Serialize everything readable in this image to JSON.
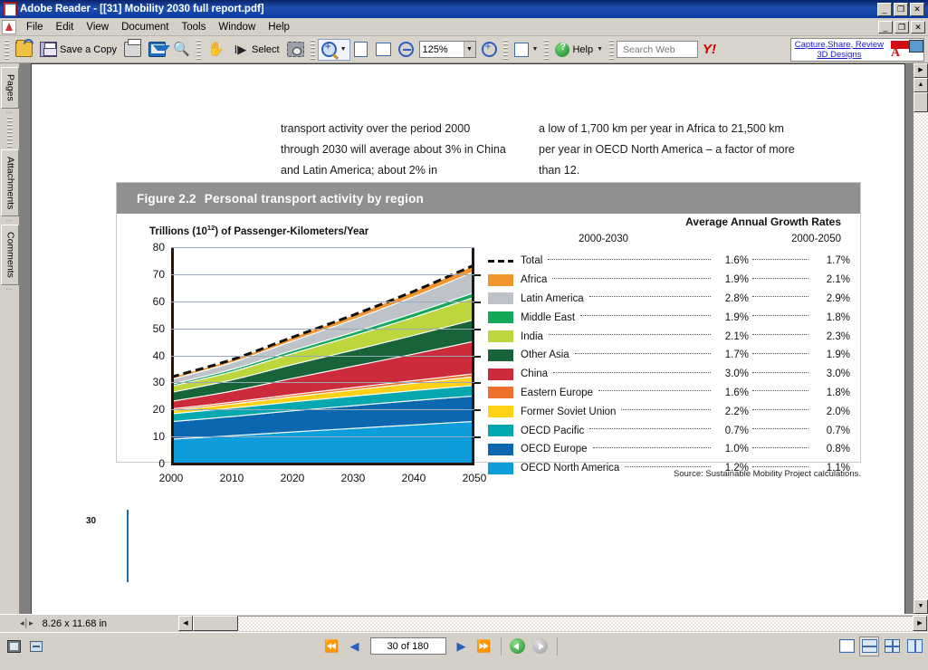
{
  "window": {
    "title": "Adobe Reader - [[31] Mobility 2030 full report.pdf]",
    "minimize": "_",
    "restore": "❐",
    "close": "✕"
  },
  "menu": [
    {
      "label": "File"
    },
    {
      "label": "Edit"
    },
    {
      "label": "View"
    },
    {
      "label": "Document"
    },
    {
      "label": "Tools"
    },
    {
      "label": "Window"
    },
    {
      "label": "Help"
    }
  ],
  "toolbar": {
    "open_label": "",
    "save_label": "Save a Copy",
    "print_label": "",
    "email_label": "",
    "search_label": "",
    "hand_label": "",
    "select_label": "Select",
    "snapshot_label": "",
    "zoom_value": "125%",
    "zoom_placeholder": "125%",
    "help_label": "Help",
    "search_web_value": "",
    "search_web_placeholder": "Search Web",
    "yahoo_label": "Y!",
    "promo_line1": "Capture,Share, Review",
    "promo_line2": "3D Designs"
  },
  "navtabs": [
    {
      "label": "Pages"
    },
    {
      "label": "Attachments"
    },
    {
      "label": "Comments"
    }
  ],
  "document": {
    "col_left": "transport activity over the period 2000 through 2030 will average about 3% in China and Latin America; about 2% in",
    "col_right": "a low of 1,700 km per year in Africa to 21,500 km per year in OECD North America – a factor of more than 12.",
    "page_number": "30",
    "source_note": "Source: Sustainable Mobility Project calculations."
  },
  "figure": {
    "number": "Figure 2.2",
    "title": "Personal transport activity by region",
    "y_axis_label_pre": "Trillions (10",
    "y_axis_label_sup": "12",
    "y_axis_label_post": ") of Passenger-Kilometers/Year",
    "legend_title": "Average Annual Growth Rates",
    "legend_col1": "2000-2030",
    "legend_col2": "2000-2050"
  },
  "chart_data": {
    "type": "area",
    "title": "Personal transport activity by region",
    "subtitle": "Figure 2.2",
    "xlabel": "",
    "ylabel": "Trillions (10¹²) of Passenger-Kilometers/Year",
    "xlim": [
      2000,
      2050
    ],
    "ylim": [
      0,
      80
    ],
    "yticks": [
      0,
      10,
      20,
      30,
      40,
      50,
      60,
      70,
      80
    ],
    "xticks": [
      2000,
      2010,
      2020,
      2030,
      2040,
      2050
    ],
    "grid": true,
    "legend_position": "right",
    "stacked": true,
    "x": [
      2000,
      2010,
      2020,
      2030,
      2040,
      2050
    ],
    "series": [
      {
        "name": "OECD North America",
        "color": "#0d9ddb",
        "values": [
          9.0,
          10.3,
          11.7,
          13.0,
          14.3,
          15.6
        ],
        "growth_2000_2030": "1.2%",
        "growth_2000_2050": "1.1%"
      },
      {
        "name": "OECD Europe",
        "color": "#0b68b0",
        "values": [
          6.5,
          7.1,
          7.8,
          8.4,
          9.0,
          9.4
        ],
        "growth_2000_2030": "1.0%",
        "growth_2000_2050": "0.8%"
      },
      {
        "name": "OECD Pacific",
        "color": "#05a8ae",
        "values": [
          2.9,
          3.1,
          3.3,
          3.5,
          3.7,
          3.9
        ],
        "growth_2000_2030": "0.7%",
        "growth_2000_2050": "0.7%"
      },
      {
        "name": "Former Soviet Union",
        "color": "#fcd116",
        "values": [
          1.2,
          1.5,
          1.9,
          2.3,
          2.7,
          3.2
        ],
        "growth_2000_2030": "2.2%",
        "growth_2000_2050": "2.0%"
      },
      {
        "name": "Eastern Europe",
        "color": "#ef6f2c",
        "values": [
          0.6,
          0.7,
          0.8,
          0.9,
          1.0,
          1.1
        ],
        "growth_2000_2030": "1.6%",
        "growth_2000_2050": "1.8%"
      },
      {
        "name": "China",
        "color": "#cc2b3c",
        "values": [
          2.8,
          4.1,
          6.0,
          7.9,
          9.8,
          12.0
        ],
        "growth_2000_2030": "3.0%",
        "growth_2000_2050": "3.0%"
      },
      {
        "name": "Other Asia",
        "color": "#17633a",
        "values": [
          3.3,
          4.1,
          5.1,
          5.9,
          6.9,
          8.0
        ],
        "growth_2000_2030": "1.7%",
        "growth_2000_2050": "1.9%"
      },
      {
        "name": "India",
        "color": "#bdd63e",
        "values": [
          2.3,
          3.0,
          4.1,
          5.3,
          6.7,
          8.3
        ],
        "growth_2000_2030": "2.1%",
        "growth_2000_2050": "2.3%"
      },
      {
        "name": "Middle East",
        "color": "#13a95b",
        "values": [
          0.7,
          0.9,
          1.1,
          1.3,
          1.5,
          1.7
        ],
        "growth_2000_2030": "1.9%",
        "growth_2000_2050": "1.8%"
      },
      {
        "name": "Latin America",
        "color": "#bdc3c9",
        "values": [
          1.8,
          2.5,
          3.5,
          4.7,
          6.1,
          7.8
        ],
        "growth_2000_2030": "2.8%",
        "growth_2000_2050": "2.9%"
      },
      {
        "name": "Africa",
        "color": "#f2952e",
        "values": [
          0.9,
          1.1,
          1.4,
          1.7,
          2.0,
          2.4
        ],
        "growth_2000_2030": "1.9%",
        "growth_2000_2050": "2.1%"
      }
    ],
    "total": {
      "name": "Total",
      "color": "#111111",
      "style": "dashed",
      "values": [
        32.0,
        38.4,
        46.7,
        54.9,
        63.7,
        73.4
      ],
      "growth_2000_2030": "1.6%",
      "growth_2000_2050": "1.7%"
    },
    "legend_order": [
      "Total",
      "Africa",
      "Latin America",
      "Middle East",
      "India",
      "Other Asia",
      "China",
      "Eastern Europe",
      "Former Soviet Union",
      "OECD Pacific",
      "OECD Europe",
      "OECD North America"
    ]
  },
  "statusbar": {
    "page_size": "8.26 x 11.68 in"
  },
  "bottombar": {
    "page_indicator": "30 of 180"
  }
}
